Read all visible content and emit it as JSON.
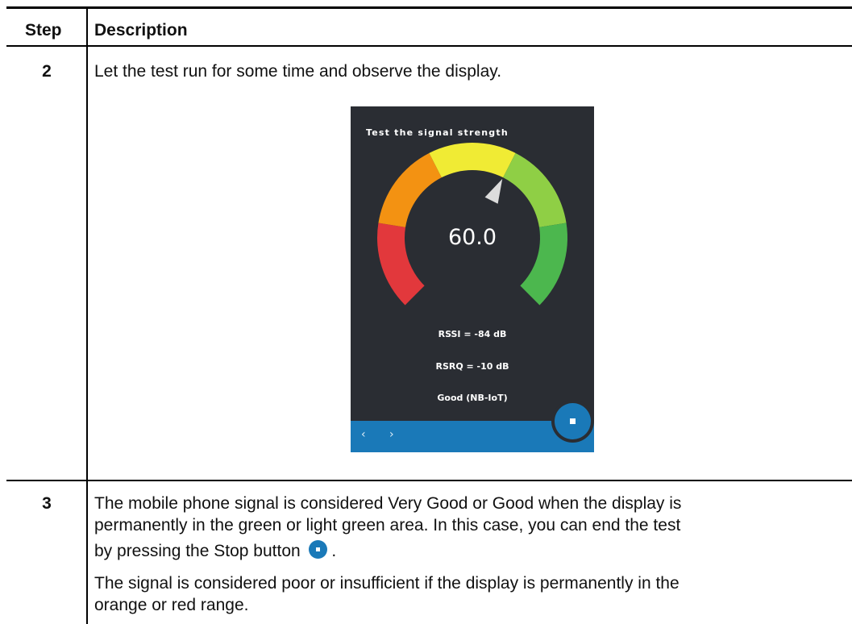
{
  "table": {
    "header": {
      "step": "Step",
      "description": "Description"
    },
    "rows": [
      {
        "step": "2",
        "description": "Let the test run for some time and observe the display."
      },
      {
        "step": "3",
        "line1": "The mobile phone signal is considered Very Good or Good when the display is",
        "line2": "permanently in the green or light green area. In this case, you can end the test",
        "line3": "by pressing the Stop button",
        "line3_end": ".",
        "line4": "The signal is considered poor or insufficient if the display is permanently in the",
        "line5": "orange or red range."
      }
    ]
  },
  "screen": {
    "title": "Test the signal strength",
    "gauge": {
      "value_text": "60.0",
      "value": 60,
      "colors": [
        "#e2383c",
        "#f39212",
        "#f0eb34",
        "#8fcf45",
        "#4cb74e"
      ]
    },
    "rssi": "RSSI = -84 dB",
    "rsrq": "RSRQ = -10 dB",
    "quality": "Good (NB-IoT)",
    "nav_prev": "‹",
    "nav_next": "›",
    "accent": "#1a79b8",
    "background": "#2a2d33"
  }
}
